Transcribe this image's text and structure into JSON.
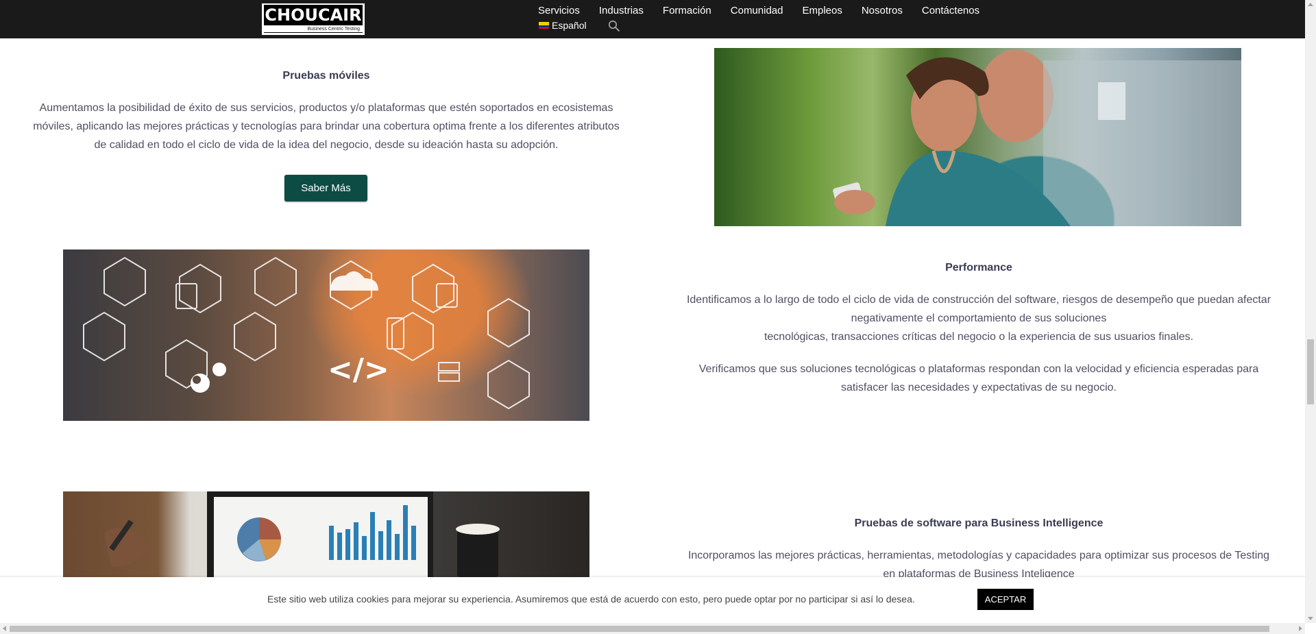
{
  "header": {
    "logo_text": "CHOUCAIR",
    "logo_tagline": "Business Centric Testing",
    "nav": [
      "Servicios",
      "Industrias",
      "Formación",
      "Comunidad",
      "Empleos",
      "Nosotros",
      "Contáctenos"
    ],
    "language": "Español"
  },
  "sections": {
    "mobile": {
      "title": "Pruebas móviles",
      "lines": [
        "Aumentamos la posibilidad de éxito de sus servicios, productos y/o plataformas que estén soportados en ecosistemas",
        "móviles, aplicando las mejores prácticas y  tecnologías para brindar una cobertura optima frente a los diferentes atributos",
        "de calidad en todo el ciclo de vida de la idea del negocio, desde su ideación hasta su adopción."
      ],
      "button": "Saber Más"
    },
    "performance": {
      "title": "Performance",
      "lines1": [
        "Identificamos a lo largo de todo el ciclo de vida de construcción del software, riesgos de desempeño que puedan afectar",
        "negativamente el comportamiento de sus soluciones",
        "tecnológicas, transacciones críticas del negocio o la experiencia de sus usuarios finales."
      ],
      "lines2": [
        "Verificamos que sus soluciones tecnológicas o plataformas respondan con la velocidad y eficiencia esperadas para",
        "satisfacer las necesidades y expectativas de su negocio."
      ]
    },
    "bi": {
      "title": "Pruebas de software para Business Intelligence",
      "lines": [
        "Incorporamos las mejores prácticas, herramientas, metodologías y capacidades para optimizar sus procesos de Testing",
        "en plataformas de Business Inteligence"
      ]
    }
  },
  "tech_image": {
    "code_symbol": "</>"
  },
  "cookie": {
    "text": "Este sitio web utiliza cookies para mejorar su experiencia. Asumiremos que está de acuerdo con esto, pero puede optar por no participar si así lo desea.",
    "accept": "ACEPTAR"
  },
  "colors": {
    "header_bg": "#1a1a1a",
    "button_bg": "#0d4c45",
    "cookie_btn": "#000000"
  }
}
